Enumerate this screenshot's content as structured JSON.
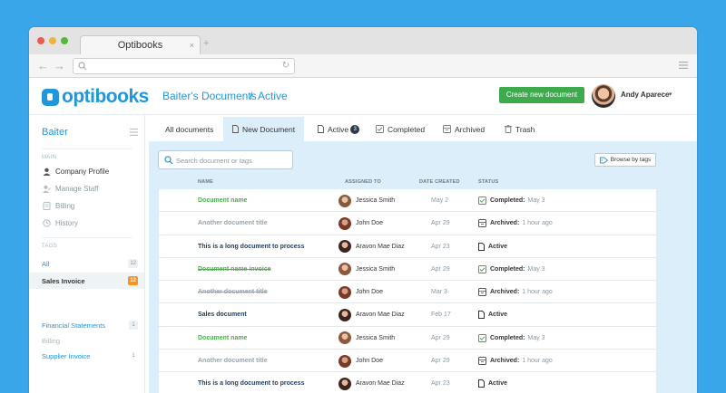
{
  "browser": {
    "tab_title": "Optibooks",
    "tab_close": "×",
    "tab_new": "+",
    "back": "←",
    "forward": "→",
    "reload": "↻"
  },
  "app": {
    "logo": "optibooks"
  },
  "breadcrumb": {
    "first": "Baiter's Documents",
    "separator": "/",
    "second": "Active"
  },
  "header": {
    "create_button": "Create new document",
    "user_name": "Andy Aparece",
    "user_caret": "▾"
  },
  "sidebar": {
    "title": "Baiter",
    "main_section": "MAIN",
    "main_items": [
      "Company Profile",
      "Manage Staff",
      "Billing",
      "History"
    ],
    "tags_section": "TAGS",
    "tags": [
      {
        "name": "All",
        "count": "12"
      },
      {
        "name": "Sales Invoice",
        "count": "12"
      },
      {
        "name": "Financial Statements",
        "count": "1"
      },
      {
        "name": "Billing",
        "count": ""
      },
      {
        "name": "Supplier Invoice",
        "count": "1"
      }
    ]
  },
  "tabs": {
    "all": "All documents",
    "new": "New Document",
    "active": "Active",
    "active_count": "3",
    "completed": "Completed",
    "archived": "Archived",
    "trash": "Trash"
  },
  "search": {
    "placeholder": "Search document or tags"
  },
  "browse_tags": "Browse by tags",
  "table": {
    "headers": {
      "name": "NAME",
      "assigned": "ASSIGNED TO",
      "date": "DATE CREATED",
      "status": "STATUS"
    },
    "rows": [
      {
        "name": "Document name",
        "assignee": "Jessica Smith",
        "date": "May 2",
        "status": "Completed:",
        "time": "May 3"
      },
      {
        "name": "Another document title",
        "assignee": "John Doe",
        "date": "Apr 29",
        "status": "Archived:",
        "time": "1 hour ago"
      },
      {
        "name": "This is a long document to process",
        "assignee": "Aravon Mae Diaz",
        "date": "Apr 23",
        "status": "Active",
        "time": ""
      },
      {
        "name": "Document name invoice",
        "assignee": "Jessica Smith",
        "date": "Apr 29",
        "status": "Completed:",
        "time": "May 3"
      },
      {
        "name": "Another document title",
        "assignee": "John Doe",
        "date": "Mar 3",
        "status": "Archived:",
        "time": "1 hour ago"
      },
      {
        "name": "Sales document",
        "assignee": "Aravon Mae Diaz",
        "date": "Feb 17",
        "status": "Active",
        "time": ""
      },
      {
        "name": "Document name",
        "assignee": "Jessica Smith",
        "date": "Apr 29",
        "status": "Completed:",
        "time": "May 3"
      },
      {
        "name": "Another document title",
        "assignee": "John Doe",
        "date": "Apr 29",
        "status": "Archived:",
        "time": "1 hour ago"
      },
      {
        "name": "This is a long document to process",
        "assignee": "Aravon Mae Diaz",
        "date": "Apr 23",
        "status": "Active",
        "time": ""
      }
    ]
  },
  "colors": {
    "accent": "#2196d8",
    "green": "#3daa4b",
    "completed_name": "#4cae4c",
    "archived_name": "#9aa3a9",
    "active_name": "#1f3b5c",
    "panel": "#dceefa",
    "background": "#3aa6ea"
  }
}
